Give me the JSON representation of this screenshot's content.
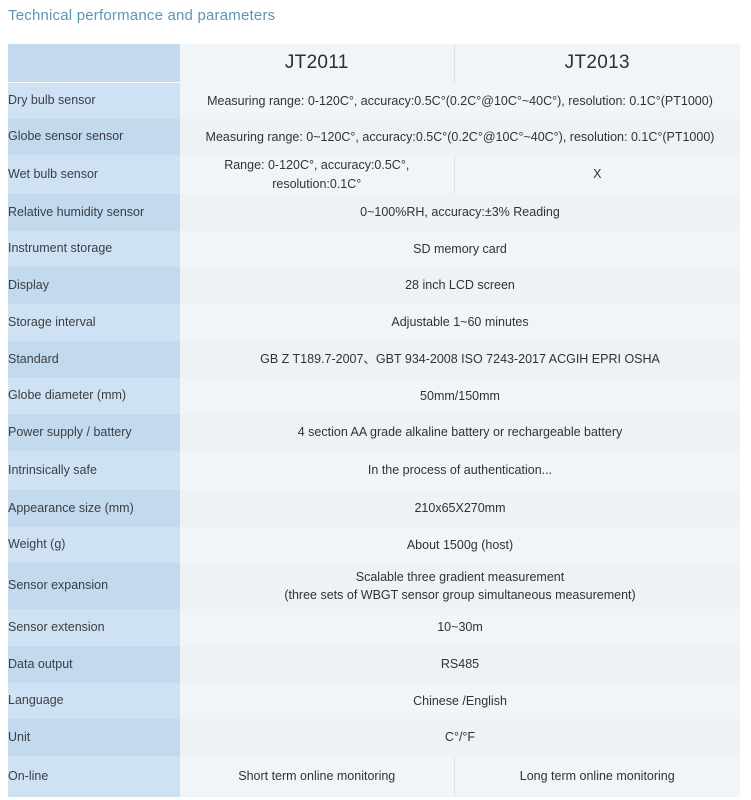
{
  "page": {
    "title": "Technical performance and parameters",
    "title_color": "#5c95b8",
    "background": "#ffffff"
  },
  "table": {
    "header": {
      "label_cell": "",
      "columns": [
        "JT2011",
        "JT2013"
      ]
    },
    "colors": {
      "label_light": "#cfe2f3",
      "label_dark": "#c2d9ee",
      "value_light": "#f2f5f7",
      "value_dark": "#eef2f5",
      "divider": "#dfe5ea",
      "text": "#2f3338"
    },
    "rows": [
      {
        "label": "Dry bulb sensor",
        "span": true,
        "value": "Measuring range: 0-120C°, accuracy:0.5C°(0.2C°@10C°~40C°), resolution: 0.1C°(PT1000)"
      },
      {
        "label": "Globe sensor sensor",
        "span": true,
        "value": "Measuring range: 0~120C°, accuracy:0.5C°(0.2C°@10C°~40C°), resolution: 0.1C°(PT1000)"
      },
      {
        "label": "Wet bulb sensor",
        "span": false,
        "value_left": "Range: 0-120C°, accuracy:0.5C°, resolution:0.1C°",
        "value_right": "X"
      },
      {
        "label": "Relative humidity sensor",
        "span": true,
        "value": "0~100%RH, accuracy:±3% Reading"
      },
      {
        "label": "Instrument storage",
        "span": true,
        "value": "SD memory card"
      },
      {
        "label": "Display",
        "span": true,
        "value": "28 inch LCD screen"
      },
      {
        "label": "Storage interval",
        "span": true,
        "value": "Adjustable 1~60 minutes"
      },
      {
        "label": "Standard",
        "span": true,
        "value": "GB Z T189.7-2007、GBT 934-2008  ISO 7243-2017 ACGIH  EPRI OSHA"
      },
      {
        "label": "Globe diameter (mm)",
        "span": true,
        "value": "50mm/150mm"
      },
      {
        "label": "Power supply / battery",
        "span": true,
        "value": "4 section AA grade alkaline battery or rechargeable battery"
      },
      {
        "label": "Intrinsically safe",
        "span": true,
        "value": "In the process of authentication..."
      },
      {
        "label": "Appearance size (mm)",
        "span": true,
        "value": "210x65X270mm"
      },
      {
        "label": "Weight (g)",
        "span": true,
        "value": "About 1500g (host)"
      },
      {
        "label": "Sensor expansion",
        "span": true,
        "value": "Scalable three gradient measurement\n(three sets of WBGT sensor group simultaneous measurement)"
      },
      {
        "label": "Sensor extension",
        "span": true,
        "value": "10~30m"
      },
      {
        "label": "Data output",
        "span": true,
        "value": "RS485"
      },
      {
        "label": "Language",
        "span": true,
        "value": "Chinese /English"
      },
      {
        "label": "Unit",
        "span": true,
        "value": "C°/°F"
      },
      {
        "label": "On-line",
        "span": false,
        "value_left": "Short term online monitoring",
        "value_right": "Long term online monitoring"
      }
    ]
  }
}
